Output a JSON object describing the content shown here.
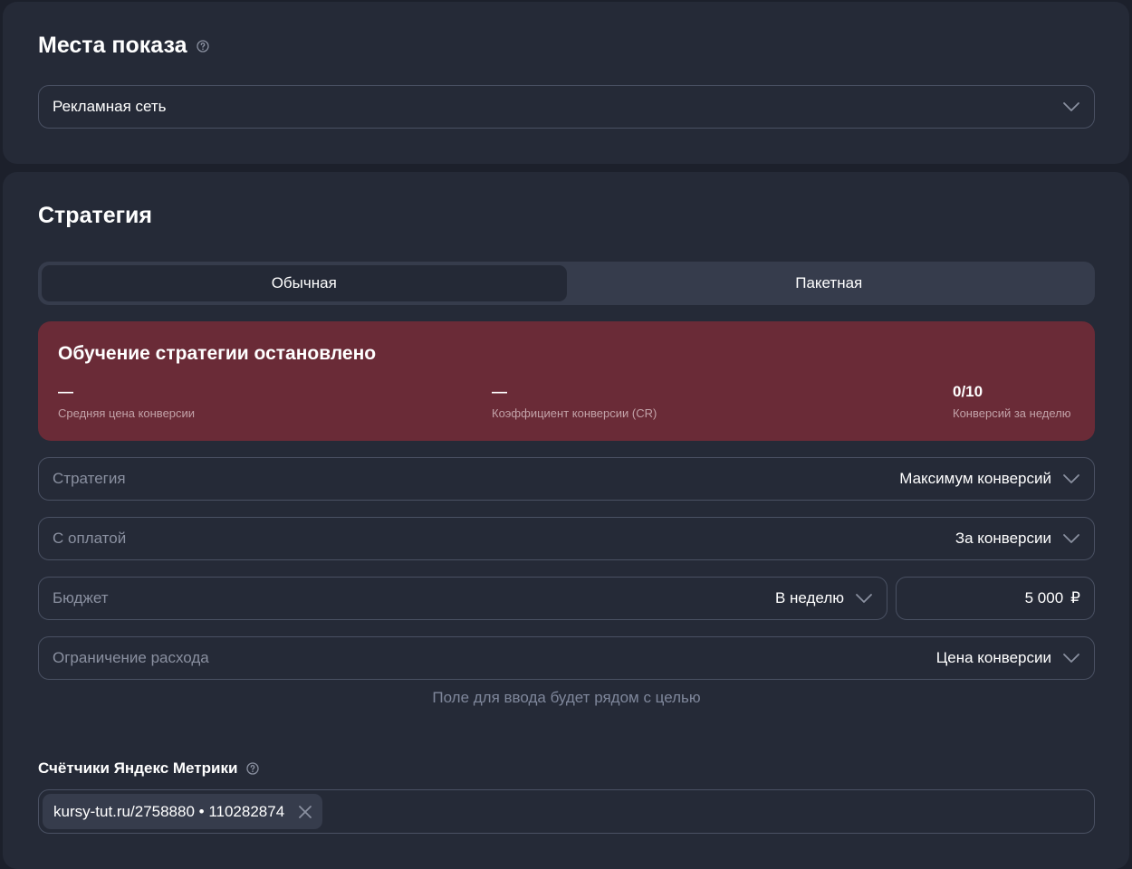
{
  "placements": {
    "title": "Места показа",
    "select_value": "Рекламная сеть"
  },
  "strategy": {
    "title": "Стратегия",
    "tabs": [
      {
        "label": "Обычная",
        "active": true
      },
      {
        "label": "Пакетная",
        "active": false
      }
    ],
    "alert": {
      "title": "Обучение стратегии остановлено",
      "metrics": [
        {
          "value": "—",
          "label": "Средняя цена конверсии"
        },
        {
          "value": "—",
          "label": "Коэффициент конверсии (CR)"
        },
        {
          "value": "0/10",
          "label": "Конверсий за неделю"
        }
      ],
      "background": "#6a2b37"
    },
    "fields": {
      "strategy": {
        "label": "Стратегия",
        "value": "Максимум конверсий"
      },
      "payment": {
        "label": "С оплатой",
        "value": "За конверсии"
      },
      "budget": {
        "label": "Бюджет",
        "value": "В неделю",
        "amount": "5 000",
        "currency": "₽"
      },
      "limit": {
        "label": "Ограничение расхода",
        "value": "Цена конверсии"
      }
    },
    "hint": "Поле для ввода будет рядом с целью",
    "counters": {
      "title": "Счётчики Яндекс Метрики",
      "chip": "kursy-tut.ru/2758880 • 110282874"
    }
  },
  "icons": {
    "help": "help-circle-icon",
    "chevron": "chevron-down-icon",
    "close": "close-icon"
  }
}
